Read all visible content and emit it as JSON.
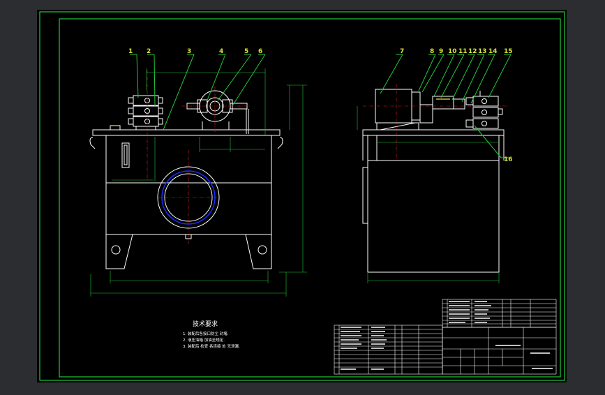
{
  "drawing": {
    "balloons_front": [
      "1",
      "2",
      "3",
      "4",
      "5",
      "6"
    ],
    "balloons_side": [
      "7",
      "8",
      "9",
      "10",
      "11",
      "12",
      "13",
      "14",
      "15",
      "16"
    ],
    "tech_req_title": "技术要求",
    "tech_req_lines": [
      "1. 装配后各接口防尘 封堵.",
      "2. 液压油箱 加油至规定.",
      "3. 装配后 检查 各连接 处 无泄漏."
    ]
  },
  "colors": {
    "background": "#000000",
    "frame": "#22c83a",
    "geometry": "#ffffff",
    "centerline": "#e21e1e",
    "flange": "#1b2cf0",
    "balloon": "#d8e03a"
  }
}
